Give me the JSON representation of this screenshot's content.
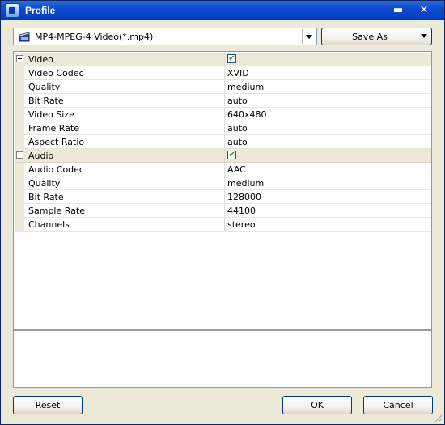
{
  "window": {
    "title": "Profile",
    "minimize_glyph": "▬",
    "close_glyph": "✕"
  },
  "toolbar": {
    "profile_value": "MP4-MPEG-4 Video(*.mp4)",
    "profile_icon": "film-clapper-icon",
    "save_as_label": "Save As"
  },
  "properties": [
    {
      "type": "category",
      "name": "Video",
      "checked": true
    },
    {
      "type": "item",
      "name": "Video Codec",
      "value": "XVID"
    },
    {
      "type": "item",
      "name": "Quality",
      "value": "medium"
    },
    {
      "type": "item",
      "name": "Bit Rate",
      "value": "auto"
    },
    {
      "type": "item",
      "name": "Video Size",
      "value": "640x480"
    },
    {
      "type": "item",
      "name": "Frame Rate",
      "value": "auto"
    },
    {
      "type": "item",
      "name": "Aspect Ratio",
      "value": "auto"
    },
    {
      "type": "category",
      "name": "Audio",
      "checked": true
    },
    {
      "type": "item",
      "name": "Audio Codec",
      "value": "AAC"
    },
    {
      "type": "item",
      "name": "Quality",
      "value": "medium"
    },
    {
      "type": "item",
      "name": "Bit Rate",
      "value": "128000"
    },
    {
      "type": "item",
      "name": "Sample Rate",
      "value": "44100"
    },
    {
      "type": "item",
      "name": "Channels",
      "value": "stereo"
    }
  ],
  "footer": {
    "reset_label": "Reset",
    "ok_label": "OK",
    "cancel_label": "Cancel"
  },
  "colors": {
    "titlebar": "#0842c4",
    "dialog_bg": "#ece9d8",
    "check_mark": "#21a121"
  }
}
